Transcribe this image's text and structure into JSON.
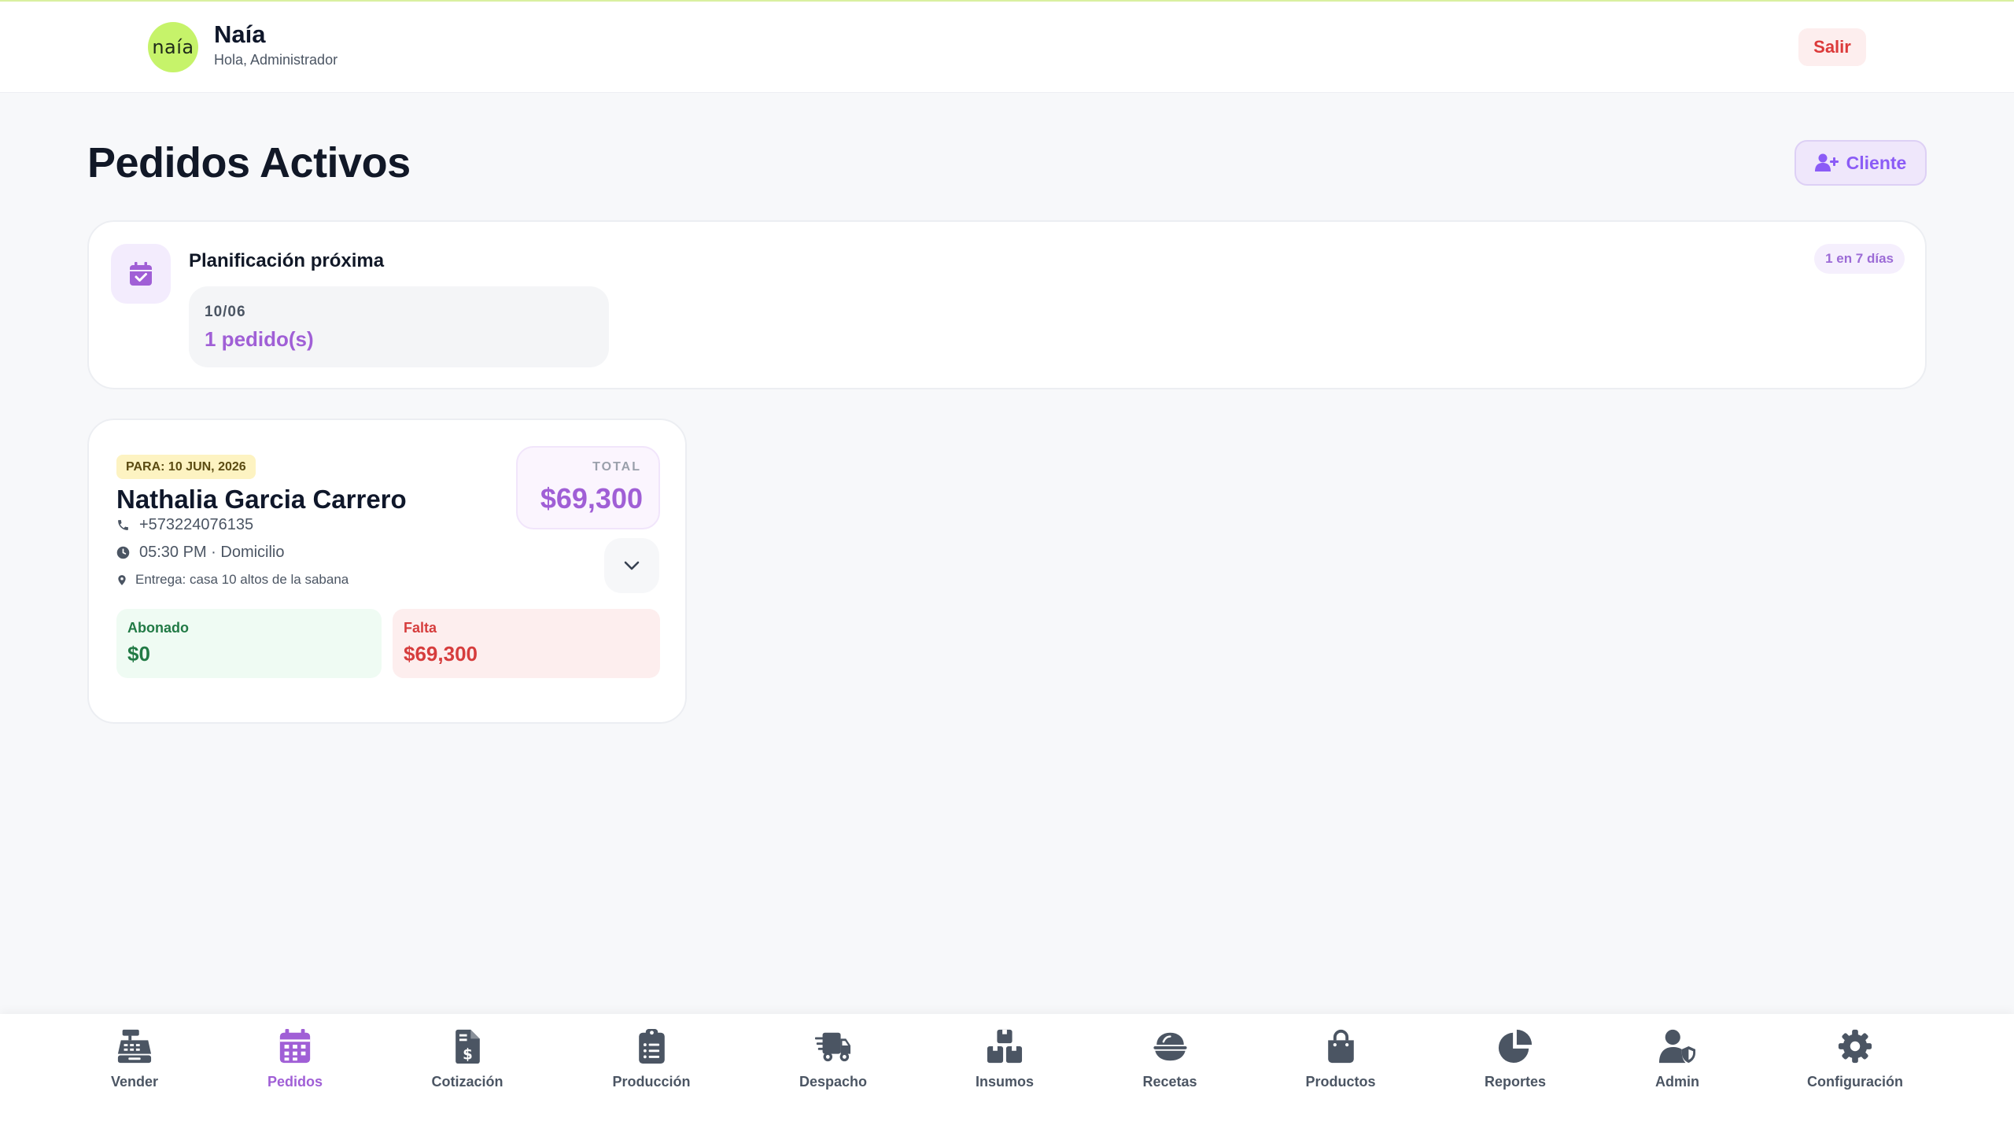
{
  "header": {
    "logo_text": "naía",
    "brand_name": "Naía",
    "greeting": "Hola, Administrador",
    "logout_label": "Salir"
  },
  "page": {
    "title": "Pedidos Activos",
    "client_button_label": "Cliente"
  },
  "planning": {
    "title": "Planificación próxima",
    "badge": "1 en 7 días",
    "days": [
      {
        "date": "10/06",
        "count": "1 pedido(s)"
      }
    ]
  },
  "orders": [
    {
      "date_label": "PARA: 10 JUN, 2026",
      "customer": "Nathalia Garcia Carrero",
      "phone": "+573224076135",
      "time_mode": "05:30 PM · Domicilio",
      "address": "Entrega: casa 10 altos de la sabana",
      "total_label": "TOTAL",
      "total": "$69,300",
      "paid_label": "Abonado",
      "paid": "$0",
      "due_label": "Falta",
      "due": "$69,300"
    }
  ],
  "nav": {
    "items": [
      {
        "label": "Vender",
        "icon": "cash-register-icon",
        "active": false
      },
      {
        "label": "Pedidos",
        "icon": "calendar-icon",
        "active": true
      },
      {
        "label": "Cotización",
        "icon": "invoice-dollar-icon",
        "active": false
      },
      {
        "label": "Producción",
        "icon": "clipboard-list-icon",
        "active": false
      },
      {
        "label": "Despacho",
        "icon": "truck-fast-icon",
        "active": false
      },
      {
        "label": "Insumos",
        "icon": "boxes-icon",
        "active": false
      },
      {
        "label": "Recetas",
        "icon": "bowl-icon",
        "active": false
      },
      {
        "label": "Productos",
        "icon": "shopping-bag-icon",
        "active": false
      },
      {
        "label": "Reportes",
        "icon": "pie-chart-icon",
        "active": false
      },
      {
        "label": "Admin",
        "icon": "user-shield-icon",
        "active": false
      },
      {
        "label": "Configuración",
        "icon": "gear-icon",
        "active": false
      }
    ]
  },
  "colors": {
    "accent": "#a05fd6",
    "logo_bg": "#c6f36a",
    "danger": "#dc3a3a",
    "success": "#217a45"
  }
}
